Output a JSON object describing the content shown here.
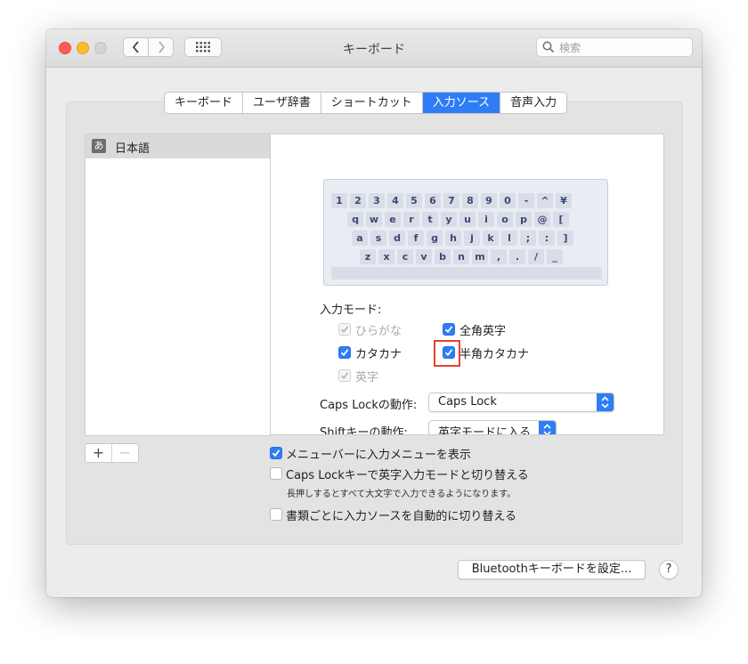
{
  "window": {
    "title": "キーボード"
  },
  "search": {
    "placeholder": "検索"
  },
  "tabs": [
    {
      "label": "キーボード"
    },
    {
      "label": "ユーザ辞書"
    },
    {
      "label": "ショートカット"
    },
    {
      "label": "入力ソース",
      "selected": true
    },
    {
      "label": "音声入力"
    }
  ],
  "sources": [
    {
      "badge": "あ",
      "label": "日本語",
      "selected": true
    }
  ],
  "keyboard": {
    "rows": [
      [
        "1",
        "2",
        "3",
        "4",
        "5",
        "6",
        "7",
        "8",
        "9",
        "0",
        "-",
        "^",
        "¥"
      ],
      [
        "q",
        "w",
        "e",
        "r",
        "t",
        "y",
        "u",
        "i",
        "o",
        "p",
        "@",
        "["
      ],
      [
        "a",
        "s",
        "d",
        "f",
        "g",
        "h",
        "j",
        "k",
        "l",
        ";",
        ":",
        "]"
      ],
      [
        "z",
        "x",
        "c",
        "v",
        "b",
        "n",
        "m",
        ",",
        ".",
        "/",
        "_"
      ]
    ]
  },
  "input_modes": {
    "heading": "入力モード:",
    "hiragana": {
      "label": "ひらがな",
      "checked": true,
      "enabled": false
    },
    "zenkaku_eiji": {
      "label": "全角英字",
      "checked": true,
      "enabled": true
    },
    "katakana": {
      "label": "カタカナ",
      "checked": true,
      "enabled": true
    },
    "hankaku_katakana": {
      "label": "半角カタカナ",
      "checked": true,
      "enabled": true
    },
    "eiji": {
      "label": "英字",
      "checked": true,
      "enabled": false
    }
  },
  "caps_lock_action": {
    "label": "Caps Lockの動作:",
    "value": "Caps Lock"
  },
  "shift_action": {
    "label": "Shiftキーの動作:",
    "value": "英字モードに入る"
  },
  "options": {
    "show_menu": {
      "label": "メニューバーに入力メニューを表示",
      "checked": true
    },
    "caps_switch": {
      "label": "Caps Lockキーで英字入力モードと切り替える",
      "checked": false,
      "note": "長押しするとすべて大文字で入力できるようになります。"
    },
    "auto_switch": {
      "label": "書類ごとに入力ソースを自動的に切り替える",
      "checked": false
    }
  },
  "buttons": {
    "add": "+",
    "remove": "−",
    "bluetooth": "Bluetoothキーボードを設定...",
    "help": "?"
  },
  "colors": {
    "accent": "#2f7df6",
    "highlight_box": "#e8412c"
  }
}
